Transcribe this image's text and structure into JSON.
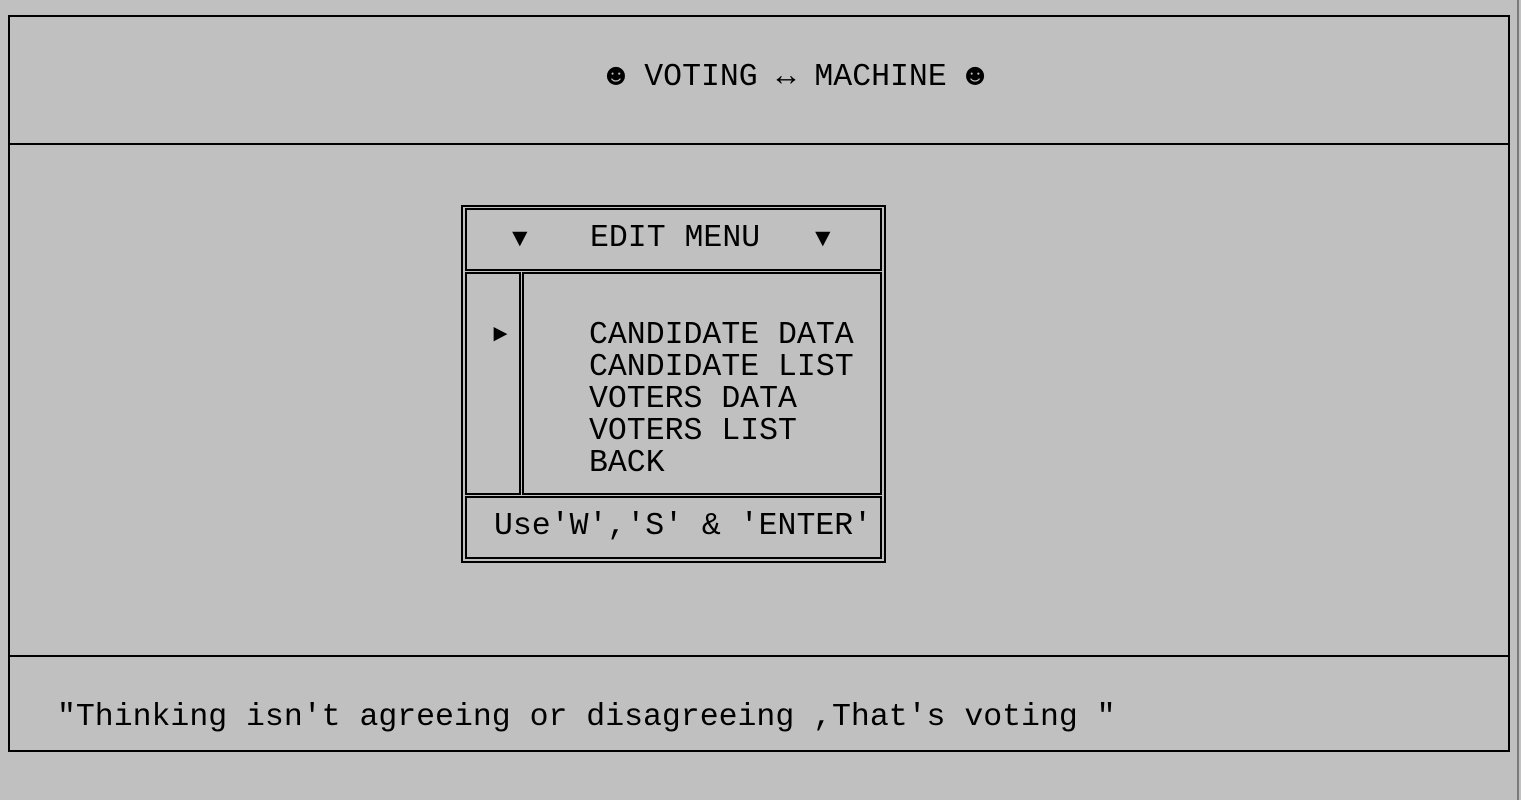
{
  "app": {
    "title": "☻ VOTING ↔ MACHINE ☻"
  },
  "menu": {
    "title": "EDIT MENU",
    "caret_left_icon": "▼",
    "caret_right_icon": "▼",
    "pointer_icon": "►",
    "selected_index": 0,
    "items": [
      {
        "label": "CANDIDATE DATA"
      },
      {
        "label": "CANDIDATE LIST"
      },
      {
        "label": "VOTERS DATA"
      },
      {
        "label": "VOTERS LIST"
      },
      {
        "label": "BACK"
      }
    ],
    "hint": "Use'W','S' & 'ENTER'"
  },
  "footer": {
    "quote": "\"Thinking isn't agreeing or disagreeing ,That's voting \""
  },
  "colors": {
    "background": "#c0c0c0",
    "foreground": "#000000"
  }
}
